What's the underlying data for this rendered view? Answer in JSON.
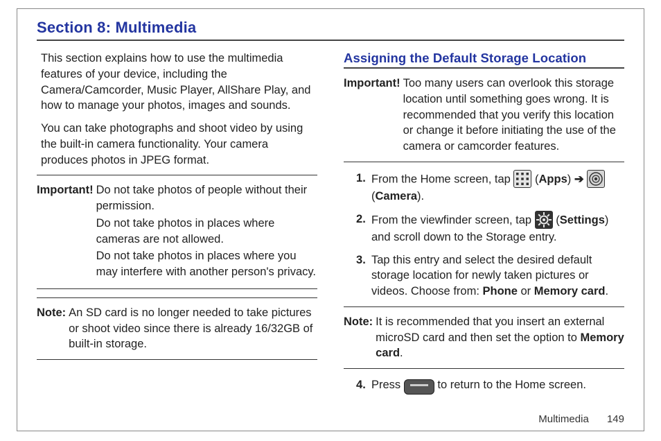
{
  "title": "Section 8: Multimedia",
  "left": {
    "intro1": "This section explains how to use the multimedia features of your device, including the Camera/Camcorder, Music Player, AllShare Play, and how to manage your photos, images and sounds.",
    "intro2": "You can take photographs and shoot video by using the built-in camera functionality. Your camera produces photos in JPEG format.",
    "important_label": "Important!",
    "important_lines": [
      "Do not take photos of people without their permission.",
      "Do not take photos in places where cameras are not allowed.",
      "Do not take photos in places where you may interfere with another person's privacy."
    ],
    "note_label": "Note:",
    "note_text": "An SD card is no longer needed to take pictures or shoot video since there is already 16/32GB of built-in storage."
  },
  "right": {
    "heading": "Assigning the Default Storage Location",
    "important_label": "Important!",
    "important_text": "Too many users can overlook this storage location until something goes wrong. It is recommended that you verify this location or change it before initiating the use of the camera or camcorder features.",
    "step1_a": "From the Home screen, tap ",
    "step1_apps": "Apps",
    "step1_arrow": "➔",
    "step1_camera": "Camera",
    "step2_a": "From the viewfinder screen, tap ",
    "step2_settings": "Settings",
    "step2_b": " and scroll down to the Storage entry.",
    "step3_a": "Tap this entry and select the desired default storage location for newly taken pictures or videos. Choose from: ",
    "step3_phone": "Phone",
    "step3_or": " or ",
    "step3_mem": "Memory card",
    "note_label": "Note:",
    "note_a": "It is recommended that you insert an external microSD card and then set the option to ",
    "note_mem": "Memory card",
    "step4_a": "Press ",
    "step4_b": " to return to the Home screen."
  },
  "footer": {
    "label": "Multimedia",
    "page": "149"
  }
}
